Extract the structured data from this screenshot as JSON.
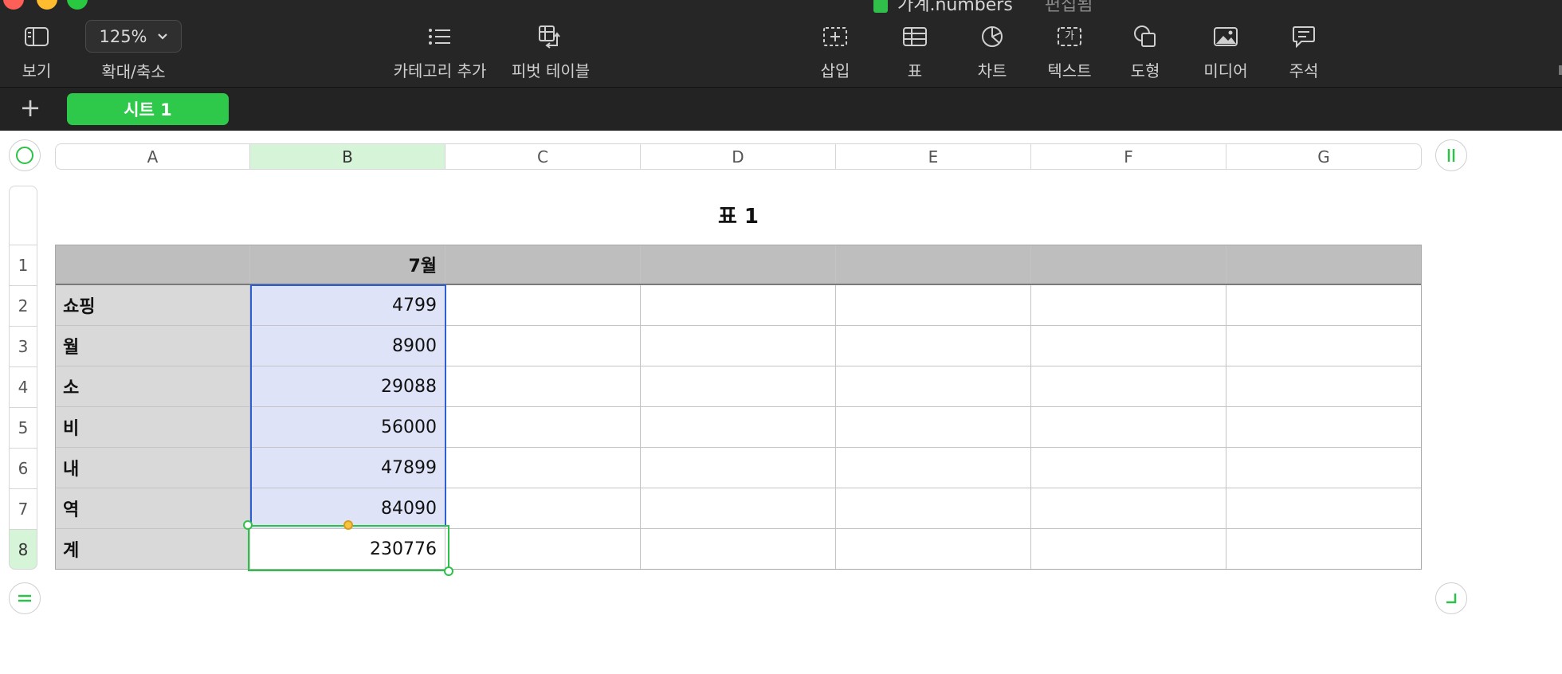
{
  "window": {
    "document_title": "가계.numbers",
    "document_subtitle": "편집됨"
  },
  "toolbar": {
    "view_label": "보기",
    "zoom_value": "125%",
    "zoom_label": "확대/축소",
    "add_category_label": "카테고리 추가",
    "pivot_table_label": "피벗 테이블",
    "insert_label": "삽입",
    "table_label": "표",
    "chart_label": "차트",
    "text_label": "텍스트",
    "text_icon_glyph": "가",
    "shape_label": "도형",
    "media_label": "미디어",
    "comment_label": "주석"
  },
  "sheets": {
    "add_symbol": "+",
    "tabs": [
      {
        "label": "시트 1",
        "active": true
      }
    ]
  },
  "columns": [
    "A",
    "B",
    "C",
    "D",
    "E",
    "F",
    "G"
  ],
  "rows": [
    "1",
    "2",
    "3",
    "4",
    "5",
    "6",
    "7",
    "8"
  ],
  "selected_column": "B",
  "selected_row": "8",
  "table": {
    "title": "표 1",
    "cells": [
      [
        "",
        "7월",
        "",
        "",
        "",
        "",
        ""
      ],
      [
        "쇼핑",
        "4799",
        "",
        "",
        "",
        "",
        ""
      ],
      [
        "월",
        "8900",
        "",
        "",
        "",
        "",
        ""
      ],
      [
        "소",
        "29088",
        "",
        "",
        "",
        "",
        ""
      ],
      [
        "비",
        "56000",
        "",
        "",
        "",
        "",
        ""
      ],
      [
        "내",
        "47899",
        "",
        "",
        "",
        "",
        ""
      ],
      [
        "역",
        "84090",
        "",
        "",
        "",
        "",
        ""
      ],
      [
        "계",
        "230776",
        "",
        "",
        "",
        "",
        ""
      ]
    ]
  },
  "colors": {
    "accent_green": "#2ec84a",
    "selection_blue": "#2d5fd3",
    "selection_fill": "#dfe3f8",
    "header_row_fill": "#bdbebd",
    "header_col_fill": "#d9d9d9"
  }
}
